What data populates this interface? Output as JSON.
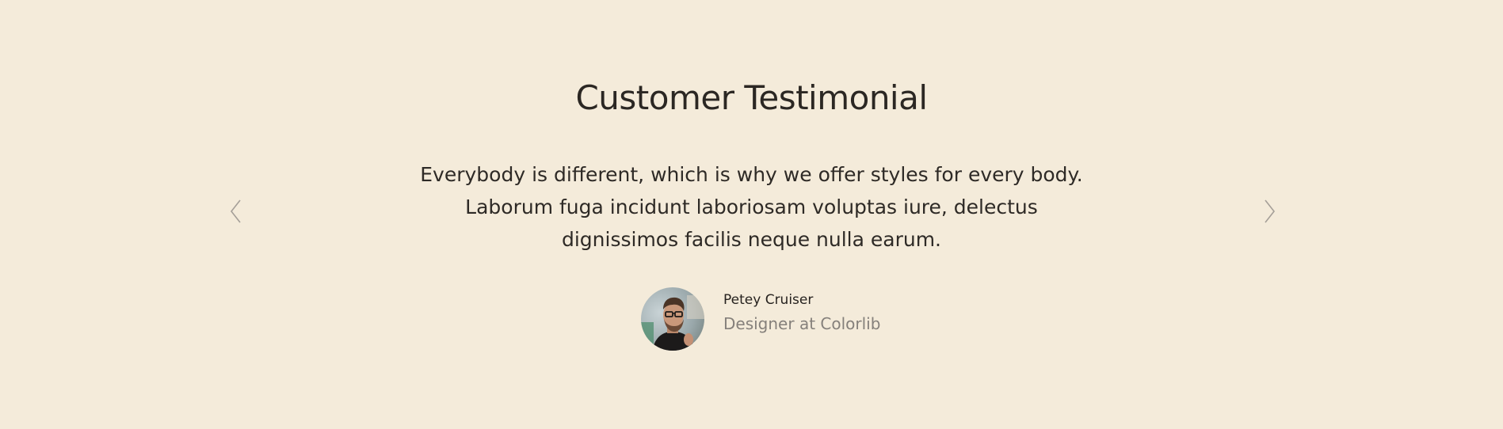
{
  "testimonial": {
    "title": "Customer Testimonial",
    "quote": "Everybody is different, which is why we offer styles for every body. Laborum fuga incidunt laboriosam voluptas iure, delectus dignissimos facilis neque nulla earum.",
    "author_name": "Petey Cruiser",
    "author_role": "Designer at Colorlib"
  },
  "icons": {
    "prev": "chevron-left-icon",
    "next": "chevron-right-icon"
  },
  "colors": {
    "background": "#f4ebda",
    "heading": "#2b2723",
    "text": "#2e2a26",
    "muted": "#85807b",
    "arrow": "#a59f98"
  }
}
